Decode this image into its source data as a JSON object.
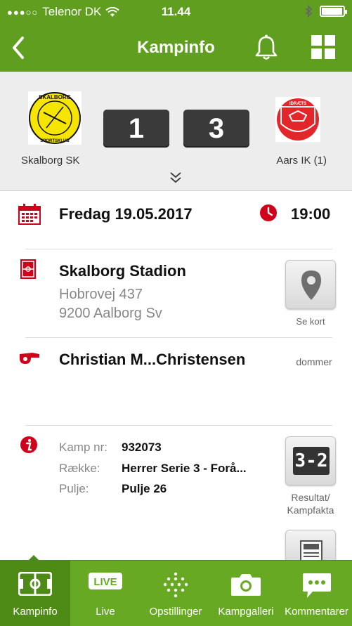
{
  "status_bar": {
    "carrier": "Telenor DK",
    "time": "11.44",
    "battery_level": 0.95
  },
  "nav": {
    "title": "Kampinfo",
    "icons": [
      "back-arrow-icon",
      "bell-icon",
      "grid-menu-icon"
    ]
  },
  "match": {
    "home_team": "Skalborg SK",
    "away_team": "Aars IK (1)",
    "home_score": "1",
    "away_score": "3",
    "home_logo_text": "SKALBORG SPORTSKLUB",
    "away_logo_text": "IDRÆTS KLUB AARS"
  },
  "schedule": {
    "date": "Fredag 19.05.2017",
    "time": "19:00"
  },
  "venue": {
    "name": "Skalborg Stadion",
    "street": "Hobrovej 437",
    "city": "9200 Aalborg Sv",
    "map_button_label": "Se kort"
  },
  "referee": {
    "name": "Christian M...Christensen",
    "role": "dommer"
  },
  "details": {
    "rows": [
      {
        "key": "Kamp nr:",
        "value": "932073"
      },
      {
        "key": "Række:",
        "value": "Herrer Serie 3 - Forå..."
      },
      {
        "key": "Pulje:",
        "value": "Pulje 26"
      }
    ],
    "result_button_label_1": "Resultat/",
    "result_button_label_2": "Kampfakta",
    "scoreboard_icon_text": "3-2"
  },
  "tabs": [
    {
      "label": "Kampinfo",
      "icon": "field-icon",
      "active": true
    },
    {
      "label": "Live",
      "icon": "live-icon",
      "badge": "LIVE"
    },
    {
      "label": "Opstillinger",
      "icon": "lineup-dots-icon"
    },
    {
      "label": "Kampgalleri",
      "icon": "camera-icon"
    },
    {
      "label": "Kommentarer",
      "icon": "comment-icon"
    }
  ],
  "colors": {
    "brand_green": "#5f9e1f",
    "tab_green": "#67a923",
    "active_tab": "#4e8a16",
    "accent_red": "#d0021b",
    "score_box": "#3a3a3a"
  }
}
